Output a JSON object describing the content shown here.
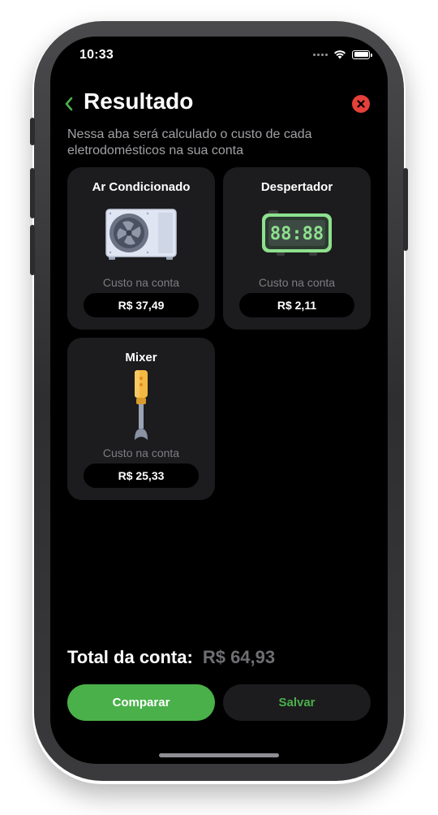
{
  "status_bar": {
    "time": "10:33"
  },
  "header": {
    "title": "Resultado",
    "subtitle": "Nessa aba será calculado o custo de cada eletrodomésticos na sua conta"
  },
  "cards": [
    {
      "name": "Ar Condicionado",
      "cost_label": "Custo na conta",
      "value": "R$ 37,49",
      "icon": "air-conditioner-icon"
    },
    {
      "name": "Despertador",
      "cost_label": "Custo na conta",
      "value": "R$ 2,11",
      "icon": "alarm-clock-icon",
      "clock_digits": "88:88"
    },
    {
      "name": "Mixer",
      "cost_label": "Custo na conta",
      "value": "R$ 25,33",
      "icon": "hand-blender-icon"
    }
  ],
  "total": {
    "label": "Total da conta:",
    "value": "R$ 64,93"
  },
  "actions": {
    "compare_label": "Comparar",
    "save_label": "Salvar"
  },
  "colors": {
    "accent_green": "#4ab04a",
    "close_red": "#e5403a",
    "card_bg": "#1c1c1e",
    "background": "#000000"
  }
}
